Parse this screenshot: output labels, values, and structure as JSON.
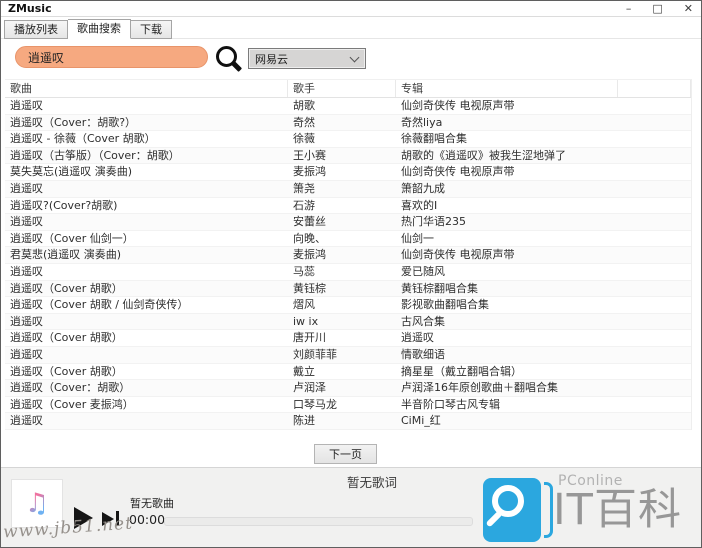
{
  "window": {
    "title": "ZMusic",
    "controls": {
      "minimize": "–",
      "maximize": "□",
      "close": "✕"
    }
  },
  "tabs": {
    "items": [
      {
        "label": "播放列表"
      },
      {
        "label": "歌曲搜索"
      },
      {
        "label": "下载"
      }
    ],
    "active_index": 1
  },
  "search": {
    "query": "逍遥叹",
    "source_selected": "网易云"
  },
  "table": {
    "headers": {
      "song": "歌曲",
      "artist": "歌手",
      "album": "专辑"
    },
    "rows": [
      {
        "song": "逍遥叹",
        "artist": "胡歌",
        "album": "仙剑奇侠传 电视原声带"
      },
      {
        "song": "逍遥叹（Cover：胡歌?）",
        "artist": "奇然",
        "album": "奇然liya"
      },
      {
        "song": "逍遥叹 - 徐薇（Cover 胡歌）",
        "artist": "徐薇",
        "album": "徐薇翻唱合集"
      },
      {
        "song": "逍遥叹（古筝版）（Cover：胡歌）",
        "artist": "王小赛",
        "album": "胡歌的《逍遥叹》被我生涩地弹了"
      },
      {
        "song": "莫失莫忘(逍遥叹 演奏曲)",
        "artist": "麦振鸿",
        "album": "仙剑奇侠传 电视原声带"
      },
      {
        "song": "逍遥叹",
        "artist": "箫尧",
        "album": "箫韶九成"
      },
      {
        "song": "逍遥叹?(Cover?胡歌)",
        "artist": "石游",
        "album": "喜欢的Ⅰ"
      },
      {
        "song": "逍遥叹",
        "artist": "安蕾丝",
        "album": "热门华语235"
      },
      {
        "song": "逍遥叹（Cover 仙剑一）",
        "artist": "向晚、",
        "album": "仙剑一"
      },
      {
        "song": "君莫悲(逍遥叹 演奏曲)",
        "artist": "麦振鸿",
        "album": "仙剑奇侠传 电视原声带"
      },
      {
        "song": "逍遥叹",
        "artist": "马蕊",
        "album": "爱已随风"
      },
      {
        "song": "逍遥叹（Cover 胡歌）",
        "artist": "黄钰棕",
        "album": "黄钰棕翻唱合集"
      },
      {
        "song": "逍遥叹（Cover 胡歌 / 仙剑奇侠传）",
        "artist": "熠风",
        "album": "影视歌曲翻唱合集"
      },
      {
        "song": "逍遥叹",
        "artist": "iw ix",
        "album": "古风合集"
      },
      {
        "song": "逍遥叹（Cover 胡歌）",
        "artist": "唐开川",
        "album": "逍遥叹"
      },
      {
        "song": "逍遥叹",
        "artist": "刘颜菲菲",
        "album": "情歌细语"
      },
      {
        "song": "逍遥叹（Cover 胡歌）",
        "artist": "戴立",
        "album": "摘星星（戴立翻唱合辑）"
      },
      {
        "song": "逍遥叹（Cover：胡歌）",
        "artist": "卢润泽",
        "album": "卢润泽16年原创歌曲＋翻唱合集"
      },
      {
        "song": "逍遥叹（Cover 麦振鸿）",
        "artist": "口琴马龙",
        "album": "半音阶口琴古风专辑"
      },
      {
        "song": "逍遥叹",
        "artist": "陈进",
        "album": "CiMi_红"
      }
    ]
  },
  "pagination": {
    "next": "下一页"
  },
  "player": {
    "no_song": "暂无歌曲",
    "elapsed": "00:00",
    "no_lyrics": "暂无歌词",
    "music_note_glyph": "♫"
  },
  "watermark": {
    "site": "www.jb51.net",
    "brand_top": "PConline",
    "brand_bottom": "IT百科"
  },
  "colors": {
    "search_fill": "#F6A980",
    "search_border": "#E8946A",
    "logo_blue": "#2BA7DF"
  }
}
